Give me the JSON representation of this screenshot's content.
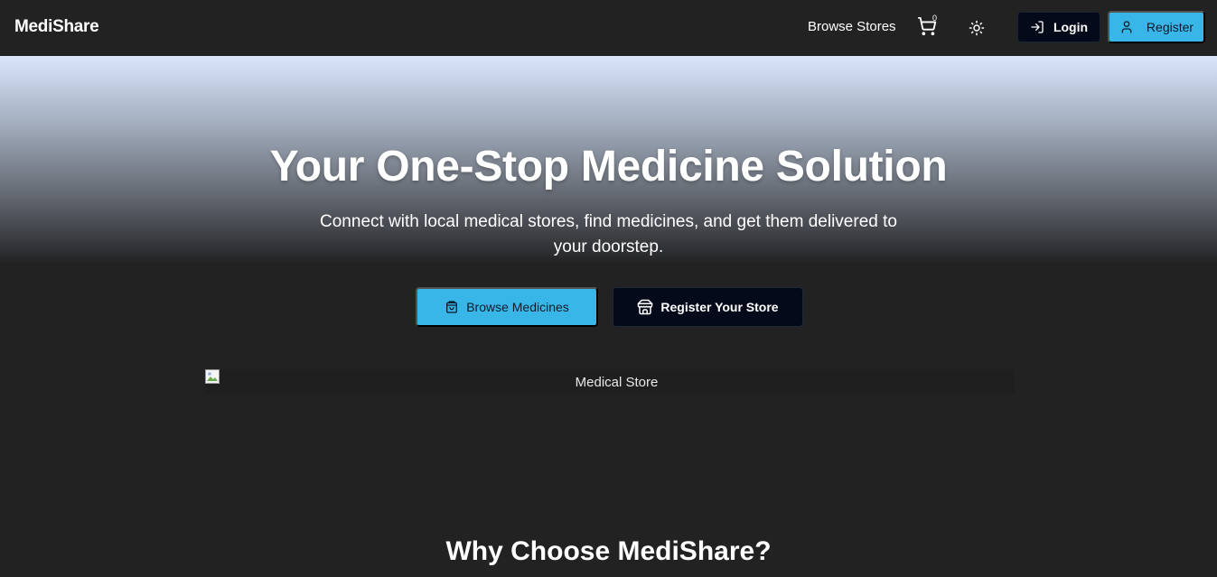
{
  "navbar": {
    "brand": "MediShare",
    "browse_stores": "Browse Stores",
    "cart_count": "0",
    "login_label": "Login",
    "register_label": "Register"
  },
  "hero": {
    "title": "Your One-Stop Medicine Solution",
    "subtitle": "Connect with local medical stores, find medicines, and get them delivered to your doorstep.",
    "browse_button": "Browse Medicines",
    "register_store_button": "Register Your Store",
    "image_alt": "Medical Store"
  },
  "features": {
    "title": "Why Choose MediShare?"
  },
  "colors": {
    "background": "#222222",
    "accent": "#38b6e8",
    "dark_button": "#050a1a"
  },
  "icons": {
    "cart": "shopping-cart-icon",
    "theme": "sun-icon",
    "login": "log-in-icon",
    "register": "user-icon",
    "browse": "shopping-bag-icon",
    "store": "store-icon"
  }
}
